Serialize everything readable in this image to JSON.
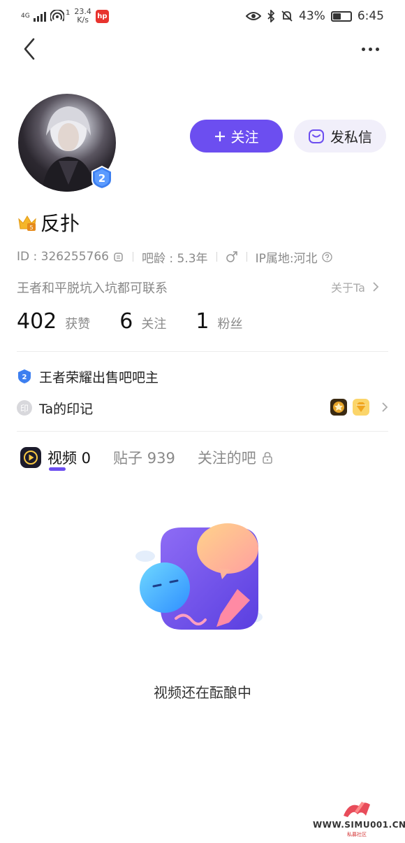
{
  "status_bar": {
    "network": "4G",
    "hotspot_count": "1",
    "speed_value": "23.4",
    "speed_unit": "K/s",
    "battery": "43%",
    "time": "6:45",
    "battery_level": 0.43
  },
  "profile": {
    "username": "反扑",
    "level": "2",
    "id_text": "ID : 326255766",
    "bar_age": "吧龄 : 5.3年",
    "ip": "IP属地:河北",
    "intro": "王者和平脱坑入坑都可联系",
    "about_label": "关于Ta",
    "stats": [
      {
        "value": "402",
        "label": "获赞"
      },
      {
        "value": "6",
        "label": "关注"
      },
      {
        "value": "1",
        "label": "粉丝"
      }
    ],
    "owner_title": "王者荣耀出售吧吧主",
    "imprint_label": "Ta的印记",
    "imprint_icon_char": "印"
  },
  "actions": {
    "follow_label": "关注",
    "message_label": "发私信"
  },
  "tabs": [
    {
      "label": "视频 0",
      "active": true
    },
    {
      "label": "贴子 939",
      "active": false
    },
    {
      "label": "关注的吧",
      "active": false
    }
  ],
  "empty_state": {
    "text": "视频还在酝酿中"
  },
  "watermark": {
    "site": "WWW.SIMU001.CN",
    "sub": "私募社区"
  },
  "colors": {
    "accent": "#6c4ef0",
    "message_bg": "#f1effa"
  }
}
